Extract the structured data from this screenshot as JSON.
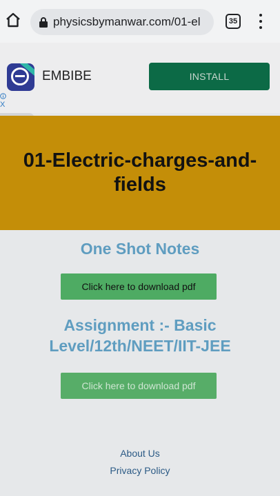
{
  "browser": {
    "url": "physicsbymanwar.com/01-el",
    "tab_count": "35"
  },
  "ad": {
    "brand": "EMBIBE",
    "install_label": "INSTALL",
    "close_glyph": "X"
  },
  "page": {
    "title": "01-Electric-charges-and-fields",
    "sections": [
      {
        "heading": "One Shot Notes",
        "button_label": "Click here to download pdf"
      },
      {
        "heading": "Assignment :- Basic Level/12th/NEET/IIT-JEE",
        "button_label": "Click here to download pdf"
      }
    ],
    "footer_links": [
      "About Us",
      "Privacy Policy"
    ]
  },
  "colors": {
    "hero_bg": "#c48e08",
    "accent_blue": "#5f9dc0",
    "button_green": "#4eab63",
    "install_green": "#0c6a46"
  },
  "icons": [
    "home-icon",
    "lock-icon",
    "tabs-icon",
    "more-vert-icon",
    "chevron-up-icon",
    "info-icon",
    "close-icon"
  ]
}
